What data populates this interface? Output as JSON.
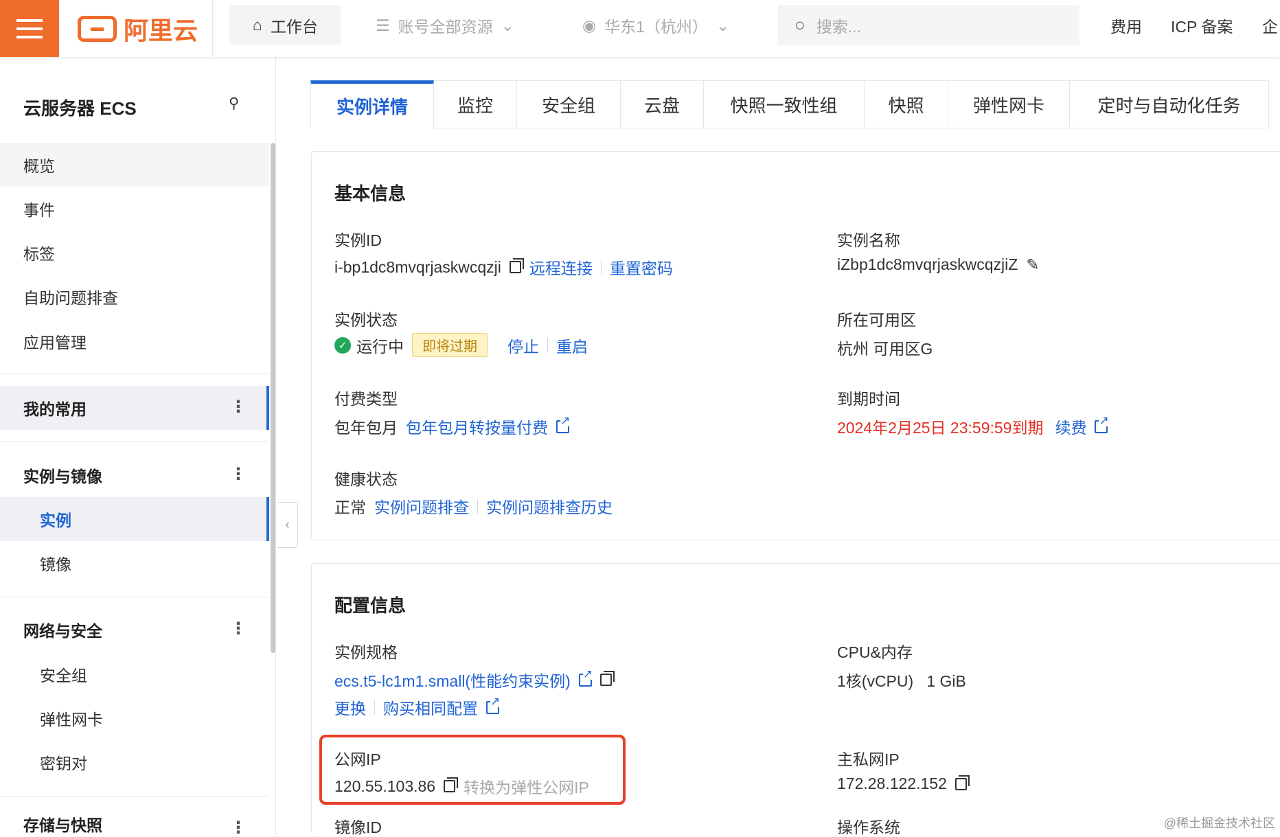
{
  "topbar": {
    "logo_text": "阿里云",
    "workbench": "工作台",
    "account_resources": "账号全部资源",
    "region": "华东1（杭州）",
    "search_placeholder": "搜索...",
    "links": [
      "费用",
      "ICP 备案",
      "企"
    ]
  },
  "sidebar": {
    "title": "云服务器 ECS",
    "top_items": [
      "概览",
      "事件",
      "标签",
      "自助问题排查",
      "应用管理"
    ],
    "favorites": "我的常用",
    "groups": [
      {
        "label": "实例与镜像",
        "items": [
          "实例",
          "镜像"
        ]
      },
      {
        "label": "网络与安全",
        "items": [
          "安全组",
          "弹性网卡",
          "密钥对"
        ]
      },
      {
        "label": "存储与快照",
        "items": []
      }
    ]
  },
  "tabs": [
    "实例详情",
    "监控",
    "安全组",
    "云盘",
    "快照一致性组",
    "快照",
    "弹性网卡",
    "定时与自动化任务"
  ],
  "basic": {
    "title": "基本信息",
    "instance_id_label": "实例ID",
    "instance_id": "i-bp1dc8mvqrjaskwcqzji",
    "remote_connect": "远程连接",
    "reset_password": "重置密码",
    "instance_name_label": "实例名称",
    "instance_name": "iZbp1dc8mvqrjaskwcqzjiZ",
    "status_label": "实例状态",
    "status": "运行中",
    "expiring_badge": "即将过期",
    "stop": "停止",
    "restart": "重启",
    "zone_label": "所在可用区",
    "zone": "杭州 可用区G",
    "billing_label": "付费类型",
    "billing": "包年包月",
    "billing_switch": "包年包月转按量付费",
    "expire_label": "到期时间",
    "expire": "2024年2月25日 23:59:59到期",
    "renew": "续费",
    "health_label": "健康状态",
    "health": "正常",
    "diagnose": "实例问题排查",
    "diagnose_history": "实例问题排查历史"
  },
  "config": {
    "title": "配置信息",
    "spec_label": "实例规格",
    "spec": "ecs.t5-lc1m1.small(性能约束实例)",
    "change": "更换",
    "buy_same": "购买相同配置",
    "cpu_mem_label": "CPU&内存",
    "cpu_mem": "1核(vCPU)   1 GiB",
    "public_ip_label": "公网IP",
    "public_ip": "120.55.103.86",
    "convert_eip": "转换为弹性公网IP",
    "private_ip_label": "主私网IP",
    "private_ip": "172.28.122.152",
    "image_id_label": "镜像ID",
    "os_label": "操作系统"
  },
  "watermark": "@稀土掘金技术社区"
}
